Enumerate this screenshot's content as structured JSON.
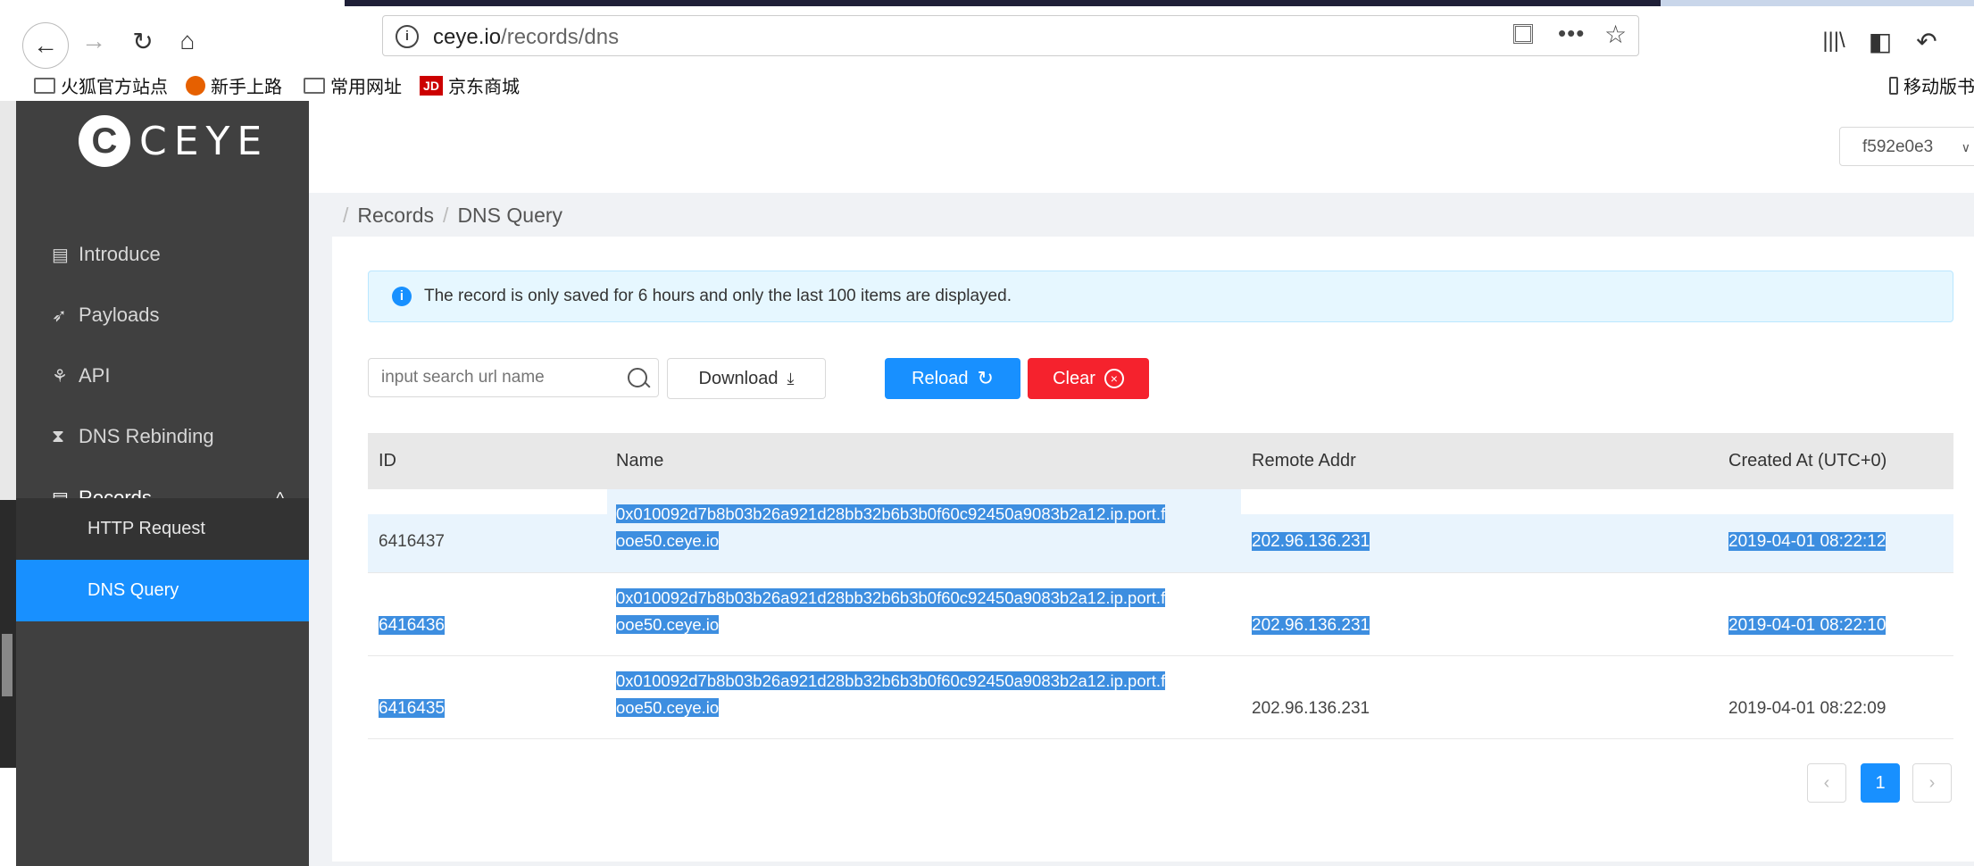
{
  "browser": {
    "url_host": "ceye.io",
    "url_path": "/records/dns",
    "bookmarks": [
      "火狐官方站点",
      "新手上路",
      "常用网址",
      "京东商城"
    ],
    "mobile_bookmarks": "移动版书",
    "jd_badge": "JD"
  },
  "logo": {
    "text": "CEYE"
  },
  "sidebar": {
    "items": [
      {
        "label": "Introduce"
      },
      {
        "label": "Payloads"
      },
      {
        "label": "API"
      },
      {
        "label": "DNS Rebinding"
      },
      {
        "label": "Records"
      }
    ],
    "submenu": [
      {
        "label": "HTTP Request"
      },
      {
        "label": "DNS Query"
      }
    ]
  },
  "header": {
    "user": "f592e0e3"
  },
  "breadcrumb": {
    "root": "Records",
    "current": "DNS Query"
  },
  "notice": {
    "icon": "i",
    "text": "The record is only saved for 6 hours and only the last 100 items are displayed."
  },
  "toolbar": {
    "search_placeholder": "input search url name",
    "download_label": "Download",
    "reload_label": "Reload",
    "clear_label": "Clear"
  },
  "table": {
    "headers": [
      "ID",
      "Name",
      "Remote Addr",
      "Created At (UTC+0)"
    ],
    "rows": [
      {
        "id": "6416437",
        "name": "0x010092d7b8b03b26a921d28bb32b6b3b0f60c92450a9083b2a12.ip.port.f",
        "name2": "ooe50.ceye.io",
        "addr": "202.96.136.231",
        "created": "2019-04-01 08:22:12"
      },
      {
        "id": "6416436",
        "name": "0x010092d7b8b03b26a921d28bb32b6b3b0f60c92450a9083b2a12.ip.port.f",
        "name2": "ooe50.ceye.io",
        "addr": "202.96.136.231",
        "created": "2019-04-01 08:22:10"
      },
      {
        "id": "6416435",
        "name": "0x010092d7b8b03b26a921d28bb32b6b3b0f60c92450a9083b2a12.ip.port.f",
        "name2": "ooe50.ceye.io",
        "addr": "202.96.136.231",
        "created": "2019-04-01 08:22:09"
      }
    ]
  },
  "pagination": {
    "prev": "‹",
    "current": "1",
    "next": "›"
  },
  "colors": {
    "primary": "#1890ff",
    "danger": "#f5222d",
    "sidebar": "#404040",
    "selection": "#3d8ee0"
  }
}
